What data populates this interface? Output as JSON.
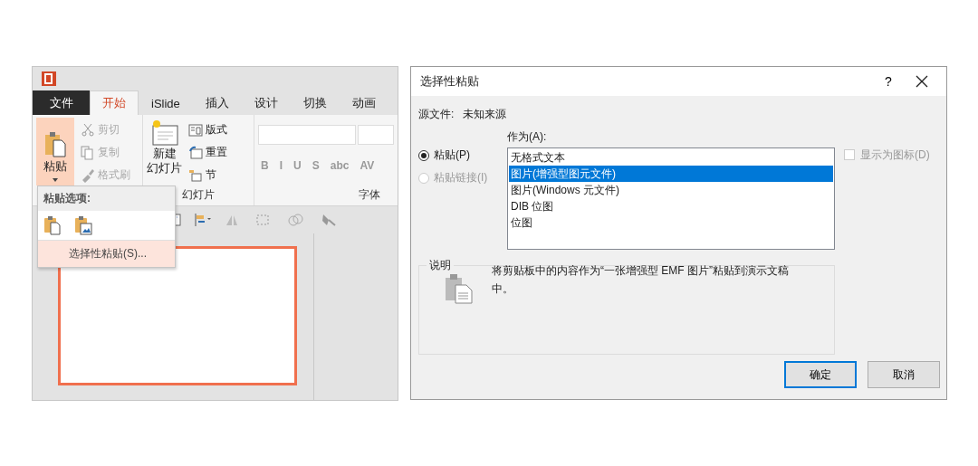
{
  "app_window": {
    "tabs": [
      {
        "label": "文件",
        "kind": "file",
        "selected": false
      },
      {
        "label": "开始",
        "kind": "tab",
        "selected": true
      },
      {
        "label": "iSlide",
        "kind": "tab",
        "selected": false
      },
      {
        "label": "插入",
        "kind": "tab",
        "selected": false
      },
      {
        "label": "设计",
        "kind": "tab",
        "selected": false
      },
      {
        "label": "切换",
        "kind": "tab",
        "selected": false
      },
      {
        "label": "动画",
        "kind": "tab",
        "selected": false
      }
    ],
    "ribbon": {
      "paste_button": {
        "label": "粘贴",
        "active": true
      },
      "clipboard_items": [
        {
          "label": "剪切",
          "disabled": true
        },
        {
          "label": "复制",
          "disabled": true
        },
        {
          "label": "格式刷",
          "disabled": true
        }
      ],
      "new_slide_button": {
        "lines": [
          "新建",
          "幻灯片"
        ]
      },
      "slide_items": [
        {
          "label": "版式"
        },
        {
          "label": "重置"
        },
        {
          "label": "节"
        }
      ],
      "group_labels": [
        "幻灯片",
        "字体"
      ],
      "font_buttons": [
        "B",
        "I",
        "U",
        "S",
        "abc",
        "AV"
      ]
    },
    "paste_menu": {
      "title": "粘贴选项:",
      "item": "选择性粘贴(S)..."
    }
  },
  "dialog": {
    "title": "选择性粘贴",
    "help": "?",
    "source_label": "源文件:",
    "source_value": "未知来源",
    "as_label": "作为(A):",
    "radios": [
      {
        "label": "粘贴(P)",
        "selected": true,
        "disabled": false
      },
      {
        "label": "粘贴链接(I)",
        "selected": false,
        "disabled": true
      }
    ],
    "list_items": [
      {
        "label": "无格式文本",
        "selected": false
      },
      {
        "label": "图片(增强型图元文件)",
        "selected": true
      },
      {
        "label": "图片(Windows 元文件)",
        "selected": false
      },
      {
        "label": "DIB 位图",
        "selected": false
      },
      {
        "label": "位图",
        "selected": false
      }
    ],
    "show_as_icon": {
      "label": "显示为图标(D)",
      "checked": false,
      "disabled": true
    },
    "description": {
      "title": "说明",
      "text": "将剪贴板中的内容作为“一张增强型 EMF 图片”粘贴到演示文稿中。"
    },
    "buttons": [
      {
        "label": "确定",
        "default": true
      },
      {
        "label": "取消",
        "default": false
      }
    ]
  }
}
